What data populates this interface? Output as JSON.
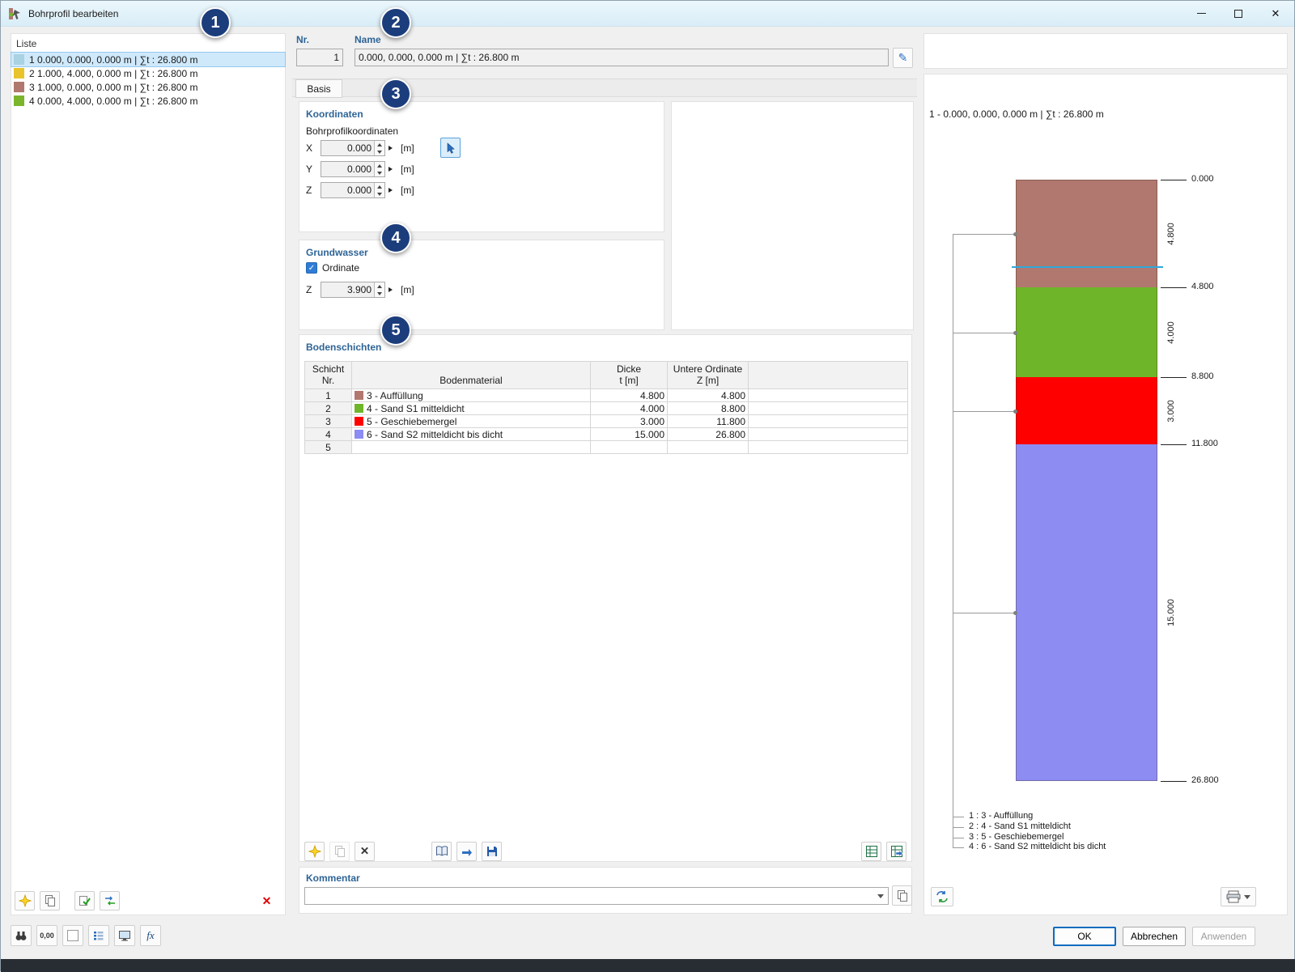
{
  "window": {
    "title": "Bohrprofil bearbeiten"
  },
  "icons": {
    "close": "✕",
    "pencil": "✎",
    "check": "✓",
    "decimal": "0,00",
    "fx": "fx",
    "delete": "✕",
    "delete_profile": "✕"
  },
  "annotations": {
    "badges": [
      "1",
      "2",
      "3",
      "4",
      "5"
    ]
  },
  "liste": {
    "label": "Liste",
    "items": [
      {
        "color": "#a9d2e2",
        "text": "1  0.000, 0.000, 0.000 m | ∑t : 26.800 m",
        "selected": true
      },
      {
        "color": "#e9c32b",
        "text": "2  1.000, 4.000, 0.000 m | ∑t : 26.800 m",
        "selected": false
      },
      {
        "color": "#b1786f",
        "text": "3  1.000, 0.000, 0.000 m | ∑t : 26.800 m",
        "selected": false
      },
      {
        "color": "#7ab52c",
        "text": "4  0.000, 4.000, 0.000 m | ∑t : 26.800 m",
        "selected": false
      }
    ]
  },
  "header": {
    "nr_label": "Nr.",
    "nr_value": "1",
    "name_label": "Name",
    "name_value": "0.000, 0.000, 0.000 m | ∑t : 26.800 m"
  },
  "tabs": {
    "basis": "Basis"
  },
  "koordinaten": {
    "title": "Koordinaten",
    "subtitle": "Bohrprofilkoordinaten",
    "rows": [
      {
        "label": "X",
        "value": "0.000",
        "unit": "[m]"
      },
      {
        "label": "Y",
        "value": "0.000",
        "unit": "[m]"
      },
      {
        "label": "Z",
        "value": "0.000",
        "unit": "[m]"
      }
    ]
  },
  "grundwasser": {
    "title": "Grundwasser",
    "checkbox_label": "Ordinate",
    "checked": true,
    "row": {
      "label": "Z",
      "value": "3.900",
      "unit": "[m]"
    }
  },
  "bodenschichten": {
    "title": "Bodenschichten",
    "columns": {
      "schicht": "Schicht\nNr.",
      "material": "Bodenmaterial",
      "dicke": "Dicke\nt [m]",
      "untere": "Untere Ordinate\nZ [m]"
    },
    "rows": [
      {
        "nr": "1",
        "color": "#b1786f",
        "material": "3 - Auffüllung",
        "dicke": "4.800",
        "untere": "4.800"
      },
      {
        "nr": "2",
        "color": "#6fb52a",
        "material": "4 - Sand S1 mitteldicht",
        "dicke": "4.000",
        "untere": "8.800"
      },
      {
        "nr": "3",
        "color": "#ff0000",
        "material": "5 - Geschiebemergel",
        "dicke": "3.000",
        "untere": "11.800"
      },
      {
        "nr": "4",
        "color": "#8c8cf2",
        "material": "6 - Sand S2 mitteldicht bis dicht",
        "dicke": "15.000",
        "untere": "26.800"
      },
      {
        "nr": "5",
        "color": "",
        "material": "",
        "dicke": "",
        "untere": ""
      }
    ]
  },
  "kommentar": {
    "title": "Kommentar",
    "value": ""
  },
  "profile_view": {
    "title": "1 - 0.000, 0.000, 0.000 m | ∑t : 26.800 m",
    "total_depth": 26.8,
    "groundwater_z": 3.9,
    "groundwater_color": "#2fa8dc",
    "depth_ticks": [
      "0.000",
      "4.800",
      "8.800",
      "11.800",
      "26.800"
    ],
    "layers": [
      {
        "thickness": 4.8,
        "thickness_label": "4.800",
        "color": "#b1786f",
        "legend": "1 : 3 - Auffüllung"
      },
      {
        "thickness": 4.0,
        "thickness_label": "4.000",
        "color": "#6fb52a",
        "legend": "2 : 4 - Sand S1 mitteldicht"
      },
      {
        "thickness": 3.0,
        "thickness_label": "3.000",
        "color": "#ff0000",
        "legend": "3 : 5 - Geschiebemergel"
      },
      {
        "thickness": 15.0,
        "thickness_label": "15.000",
        "color": "#8c8cf2",
        "legend": "4 : 6 - Sand S2 mitteldicht bis dicht"
      }
    ]
  },
  "footer": {
    "ok": "OK",
    "abbrechen": "Abbrechen",
    "anwenden": "Anwenden"
  }
}
